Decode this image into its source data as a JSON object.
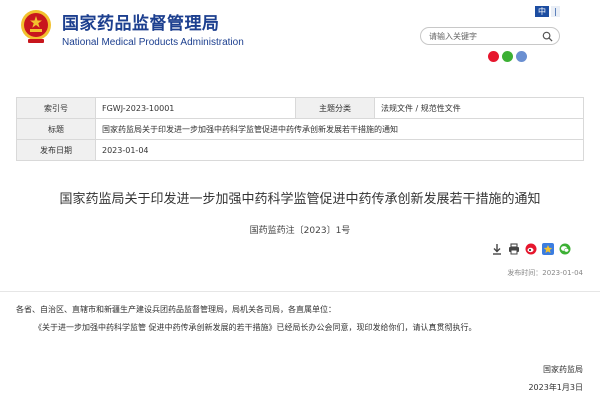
{
  "header": {
    "title_cn": "国家药品监督管理局",
    "title_en": "National Medical Products Administration",
    "lang_label": "中",
    "lang_label_2": "|",
    "search_placeholder": "请输入关键字"
  },
  "colors": {
    "brand_blue": "#1c3f8f",
    "emblem_red": "#c8161d",
    "emblem_gold": "#f2c12e",
    "wechat_green": "#3cb034",
    "weibo_red": "#e6162d"
  },
  "icons": {
    "search": "search-icon",
    "weibo": "weibo-icon",
    "wechat": "wechat-icon",
    "share": "share-icon",
    "download": "download-icon",
    "print": "print-icon",
    "favorite": "star-icon"
  },
  "meta": {
    "index_label": "索引号",
    "index_value": "FGWJ-2023-10001",
    "category_label": "主题分类",
    "category_value": "法规文件 / 规范性文件",
    "title_label": "标题",
    "title_value": "国家药监局关于印发进一步加强中药科学监管促进中药传承创新发展若干措施的通知",
    "date_label": "发布日期",
    "date_value": "2023-01-04"
  },
  "document": {
    "title": "国家药监局关于印发进一步加强中药科学监管促进中药传承创新发展若干措施的通知",
    "number": "国药监药注〔2023〕1号",
    "publish_time": "发布时间：2023-01-04",
    "salutation": "各省、自治区、直辖市和新疆生产建设兵团药品监督管理局，局机关各司局，各直属单位：",
    "body": "《关于进一步加强中药科学监管 促进中药传承创新发展的若干措施》已经局长办公会同意，现印发给你们，请认真贯彻执行。",
    "sign_org": "国家药监局",
    "sign_date": "2023年1月3日"
  }
}
